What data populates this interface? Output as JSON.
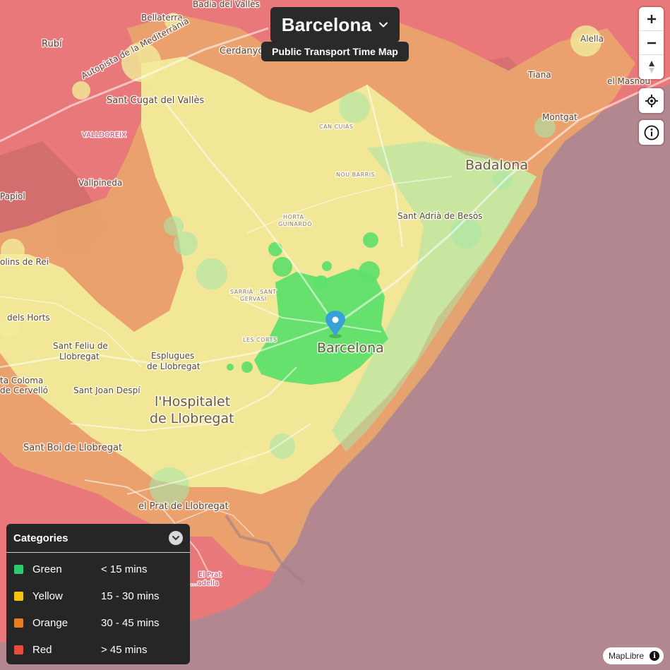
{
  "header": {
    "city": "Barcelona",
    "subtitle": "Public Transport Time Map"
  },
  "controls": {
    "zoom_in": "+",
    "zoom_out": "−",
    "compass": "▲",
    "locate_icon": "crosshair-icon",
    "info_icon": "info-icon"
  },
  "legend": {
    "title": "Categories",
    "items": [
      {
        "name": "Green",
        "range": "< 15 mins",
        "color": "#2ecc71"
      },
      {
        "name": "Yellow",
        "range": "15 - 30 mins",
        "color": "#f1c40f"
      },
      {
        "name": "Orange",
        "range": "30 - 45 mins",
        "color": "#e67e22"
      },
      {
        "name": "Red",
        "range": "> 45 mins",
        "color": "#e74c3c"
      }
    ]
  },
  "attribution": {
    "text": "MapLibre",
    "icon": "i"
  },
  "map": {
    "labels": {
      "bellaterra": "Bellaterra",
      "badia": "Badia del Vallès",
      "rubi": "Rubí",
      "cerdanyola": "Cerdanyo",
      "autopista": "Autopista de la Mediterrània",
      "sant_cugat": "Sant Cugat del Vallès",
      "valldoreix": "VALLDOREIX",
      "alella": "Alella",
      "tiana": "Tiana",
      "masnou": "el Masnou",
      "montgat": "Montgat",
      "badalona": "Badalona",
      "can_cuias": "CAN CUIÀS",
      "nou_barris": "NOU BARRIS",
      "vallpineda": "Vallpineda",
      "papiol": "Papiol",
      "horta": "HORTA-",
      "guinardo": "GUINARDÓ",
      "sant_adria": "Sant Adrià de Besòs",
      "molins": "olins de Rei",
      "sarria": "SARRIÀ - SANT",
      "gervasi": "GERVASI",
      "dels_horts": "dels Horts",
      "les_corts": "LES CORTS",
      "barcelona": "Barcelona",
      "sant_feliu1": "Sant Feliu de",
      "sant_feliu2": "Llobregat",
      "esplugues1": "Esplugues",
      "esplugues2": "de Llobregat",
      "coloma1": "ta Coloma",
      "coloma2": "de Cervelló",
      "sant_joan": "Sant Joan Despí",
      "hospitalet1": "l'Hospitalet",
      "hospitalet2": "de Llobregat",
      "sant_boi": "Sant Boi de Llobregat",
      "prat": "el Prat de Llobregat",
      "prat_small1": "El Prat",
      "prat_small2": "...adella"
    }
  }
}
